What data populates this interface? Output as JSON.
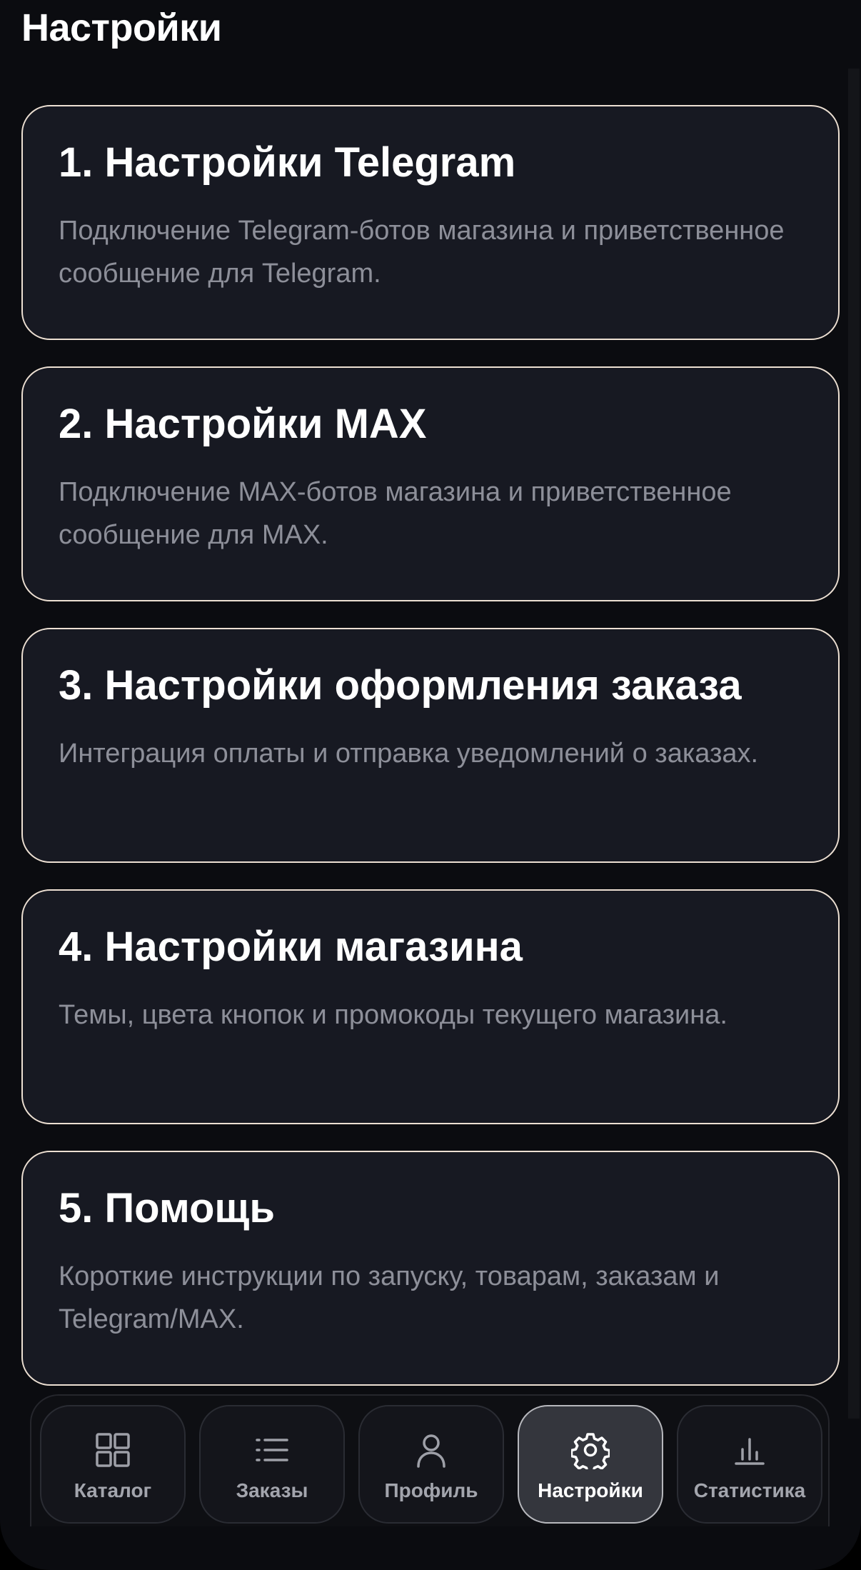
{
  "header": {
    "title": "Настройки"
  },
  "cards": [
    {
      "title": "1. Настройки Telegram",
      "description": "Подключение Telegram-ботов магазина и приветственное сообщение для Telegram."
    },
    {
      "title": "2. Настройки MAX",
      "description": "Подключение MAX-ботов магазина и приветственное сообщение для MAX."
    },
    {
      "title": "3. Настройки оформления заказа",
      "description": "Интеграция оплаты и отправка уведомлений о заказах."
    },
    {
      "title": "4. Настройки магазина",
      "description": "Темы, цвета кнопок и промокоды текущего магазина."
    },
    {
      "title": "5. Помощь",
      "description": "Короткие инструкции по запуску, товарам, заказам и Telegram/MAX."
    }
  ],
  "tabbar": {
    "active": "settings",
    "items": [
      {
        "id": "catalog",
        "label": "Каталог",
        "icon": "grid-icon"
      },
      {
        "id": "orders",
        "label": "Заказы",
        "icon": "list-icon"
      },
      {
        "id": "profile",
        "label": "Профиль",
        "icon": "person-icon"
      },
      {
        "id": "settings",
        "label": "Настройки",
        "icon": "gear-icon"
      },
      {
        "id": "stats",
        "label": "Статистика",
        "icon": "bar-chart-icon"
      }
    ]
  },
  "colors": {
    "background": "#0b0c10",
    "card_background": "#171922",
    "card_border": "#ede0d3",
    "title_text": "#ffffff",
    "description_text": "#8d8f99",
    "tab_active_background": "#34363d"
  }
}
